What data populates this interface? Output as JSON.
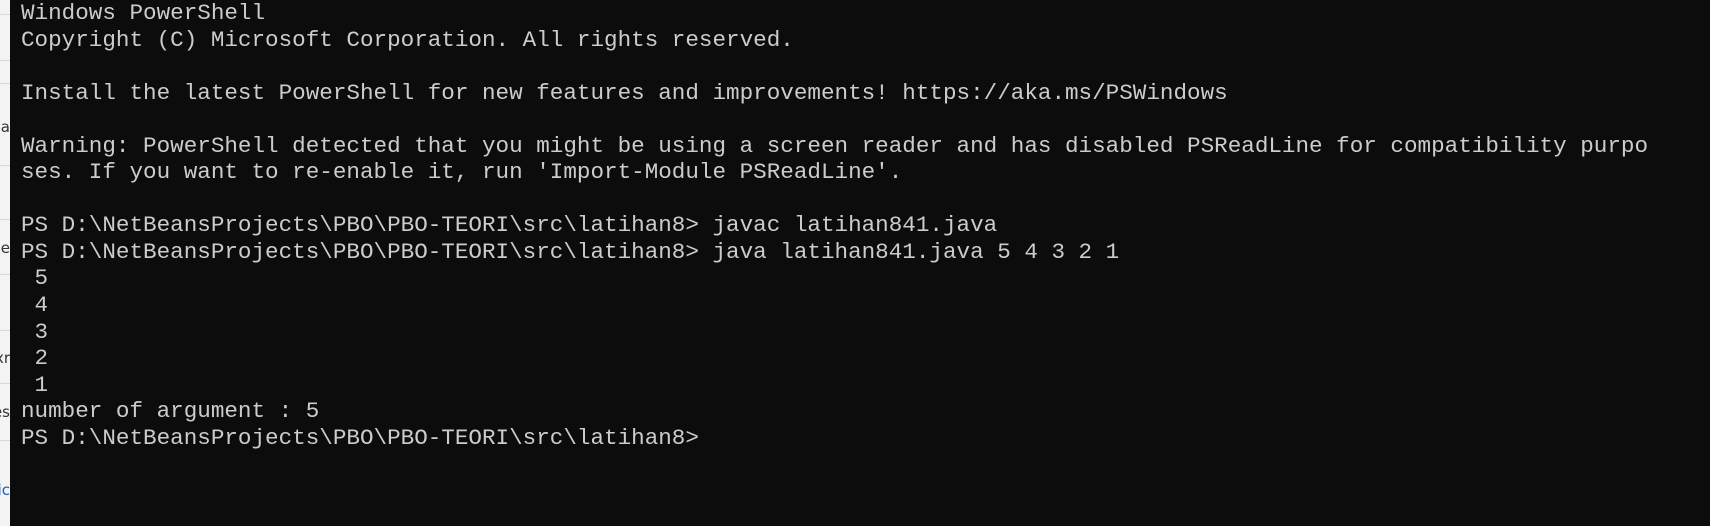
{
  "side_panel": {
    "fragments": [
      {
        "text": "a",
        "link": false
      },
      {
        "text": "je",
        "link": false
      },
      {
        "text": "xr",
        "link": false
      },
      {
        "text": "es",
        "link": false
      },
      {
        "text": "ic",
        "link": true
      }
    ]
  },
  "terminal": {
    "lines": [
      "Windows PowerShell",
      "Copyright (C) Microsoft Corporation. All rights reserved.",
      "",
      "Install the latest PowerShell for new features and improvements! https://aka.ms/PSWindows",
      "",
      "Warning: PowerShell detected that you might be using a screen reader and has disabled PSReadLine for compatibility purpo",
      "ses. If you want to re-enable it, run 'Import-Module PSReadLine'.",
      "",
      "PS D:\\NetBeansProjects\\PBO\\PBO-TEORI\\src\\latihan8> javac latihan841.java",
      "PS D:\\NetBeansProjects\\PBO\\PBO-TEORI\\src\\latihan8> java latihan841.java 5 4 3 2 1",
      " 5",
      " 4",
      " 3",
      " 2",
      " 1",
      "number of argument : 5",
      "PS D:\\NetBeansProjects\\PBO\\PBO-TEORI\\src\\latihan8>"
    ],
    "background": "#0c0c0c",
    "foreground": "#cccccc"
  }
}
